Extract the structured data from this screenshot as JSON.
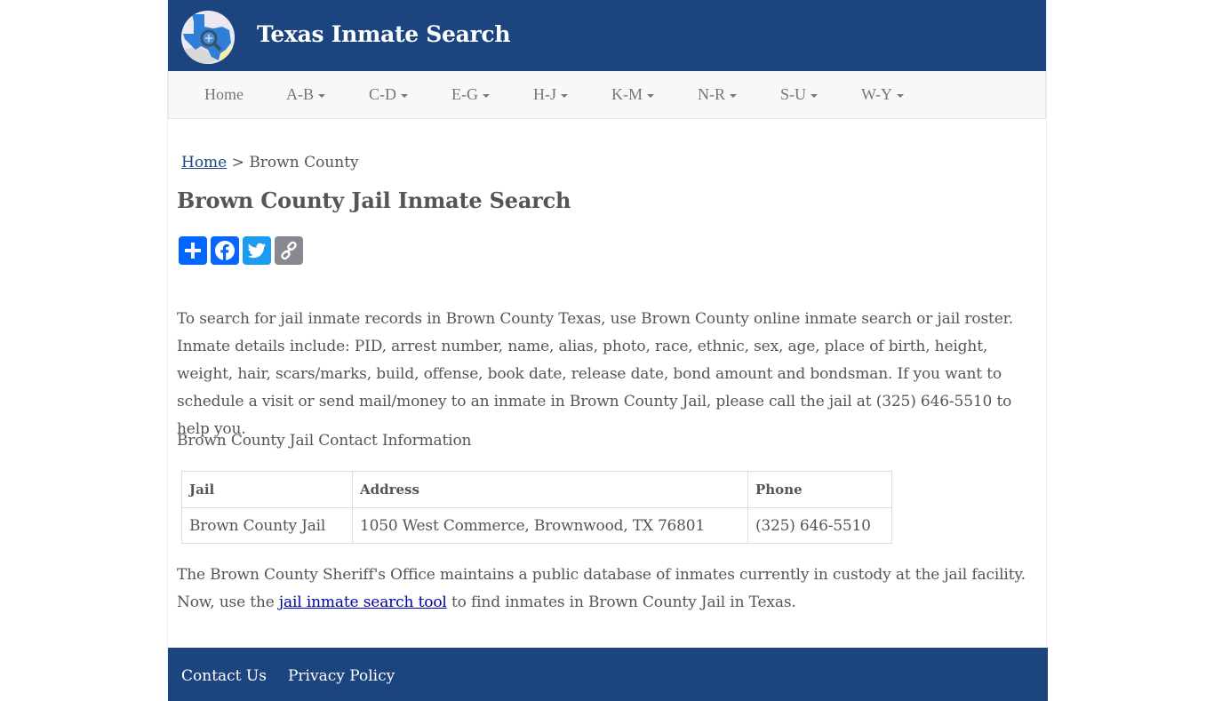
{
  "header": {
    "site_title": "Texas Inmate Search",
    "logo_icon": "texas-map-magnifier-logo",
    "colors": {
      "brand": "#1c4580",
      "nav_bg": "#f8f8f8"
    }
  },
  "nav": {
    "items": [
      {
        "label": "Home",
        "dropdown": false
      },
      {
        "label": "A-B",
        "dropdown": true
      },
      {
        "label": "C-D",
        "dropdown": true
      },
      {
        "label": "E-G",
        "dropdown": true
      },
      {
        "label": "H-J",
        "dropdown": true
      },
      {
        "label": "K-M",
        "dropdown": true
      },
      {
        "label": "N-R",
        "dropdown": true
      },
      {
        "label": "S-U",
        "dropdown": true
      },
      {
        "label": "W-Y",
        "dropdown": true
      }
    ]
  },
  "breadcrumb": {
    "home": "Home",
    "separator": " > ",
    "current": "Brown County"
  },
  "page_title": "Brown County Jail Inmate Search",
  "share": {
    "buttons": [
      {
        "name": "share",
        "icon": "plus-icon",
        "color": "#0166ff"
      },
      {
        "name": "facebook",
        "icon": "facebook-icon",
        "color": "#0866ff"
      },
      {
        "name": "twitter",
        "icon": "twitter-icon",
        "color": "#1d9bf0"
      },
      {
        "name": "copy-link",
        "icon": "link-icon",
        "color": "#888990"
      }
    ]
  },
  "intro_paragraph": "To search for jail inmate records in Brown County Texas, use Brown County online inmate search or jail roster. Inmate details include: PID, arrest number, name, alias, photo, race, ethnic, sex, age, place of birth, height, weight, hair, scars/marks, build, offense, book date, release date, bond amount and bondsman. If you want to schedule a visit or send mail/money to an inmate in Brown County Jail, please call the jail at (325) 646-5510 to help you.",
  "contact_heading": "Brown County Jail Contact Information",
  "contact_table": {
    "headers": [
      "Jail",
      "Address",
      "Phone"
    ],
    "rows": [
      [
        "Brown County Jail",
        "1050 West Commerce, Brownwood, TX 76801",
        "(325) 646-5510"
      ]
    ]
  },
  "closing": {
    "line1": "The Brown County Sheriff's Office maintains a public database of inmates currently in custody at the jail facility.",
    "before_link": "Now, use the ",
    "link_text": "jail inmate search tool",
    "after_link": " to find inmates in Brown County Jail in Texas."
  },
  "footer": {
    "links": [
      "Contact Us",
      "Privacy Policy"
    ]
  }
}
